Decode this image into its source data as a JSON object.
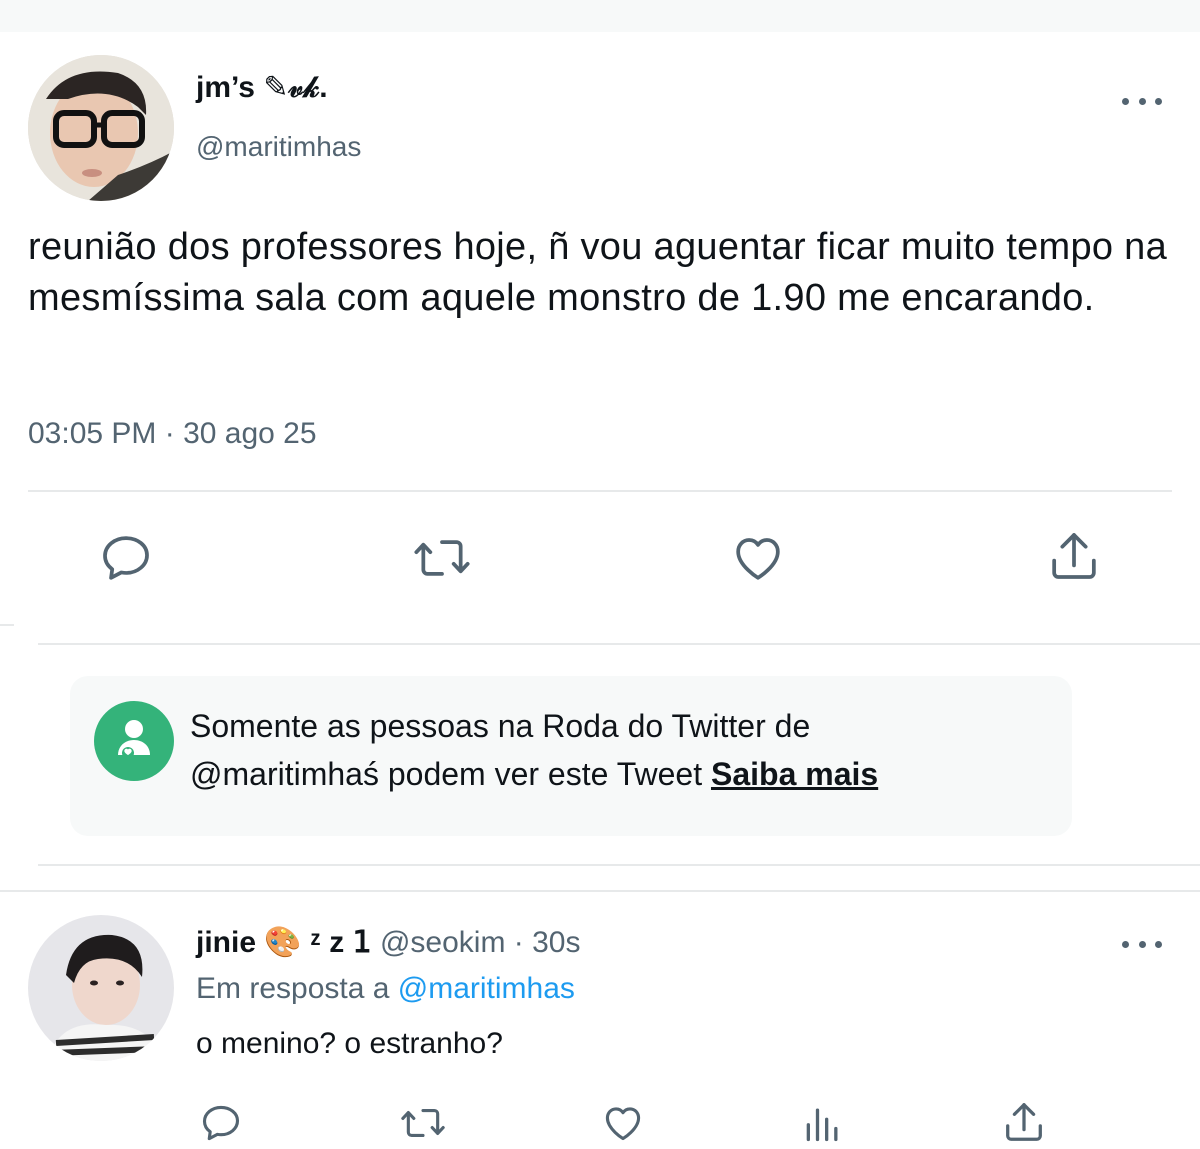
{
  "main_tweet": {
    "display_name": "jm’s ✎𝓋𝓀.",
    "handle": "@maritimhas",
    "text": "reunião dos professores hoje, ñ vou aguentar ficar muito tempo na mesmíssima sala com aquele monstro de 1.90 me encarando.",
    "timestamp": "03:05 PM · 30 ago 25",
    "more_icon": "more-horizontal-icon",
    "actions": [
      {
        "name": "reply",
        "icon": "reply-icon"
      },
      {
        "name": "retweet",
        "icon": "retweet-icon"
      },
      {
        "name": "like",
        "icon": "heart-icon"
      },
      {
        "name": "share",
        "icon": "share-icon"
      }
    ]
  },
  "circle_notice": {
    "icon": "twitter-circle-icon",
    "line1": "Somente as pessoas na Roda do Twitter de",
    "line2": "@maritimhaś podem ver este Tweet ",
    "link": "Saiba mais"
  },
  "reply_tweet": {
    "display_name": "jinie 🎨 ᶻ z 𝟣",
    "handle_time": " @seokim · 30s",
    "reply_prefix": "Em resposta a ",
    "reply_mention": "@maritimhas",
    "text": "o menino? o estranho?",
    "more_icon": "more-horizontal-icon",
    "actions": [
      {
        "name": "reply",
        "icon": "reply-icon"
      },
      {
        "name": "retweet",
        "icon": "retweet-icon"
      },
      {
        "name": "like",
        "icon": "heart-icon"
      },
      {
        "name": "analytics",
        "icon": "analytics-icon"
      },
      {
        "name": "share",
        "icon": "share-icon"
      }
    ]
  },
  "colors": {
    "text_primary": "#0f1419",
    "text_secondary": "#536471",
    "mention": "#1d9bf0",
    "circle_green": "#34b37a",
    "divider": "#e7e9ea"
  }
}
